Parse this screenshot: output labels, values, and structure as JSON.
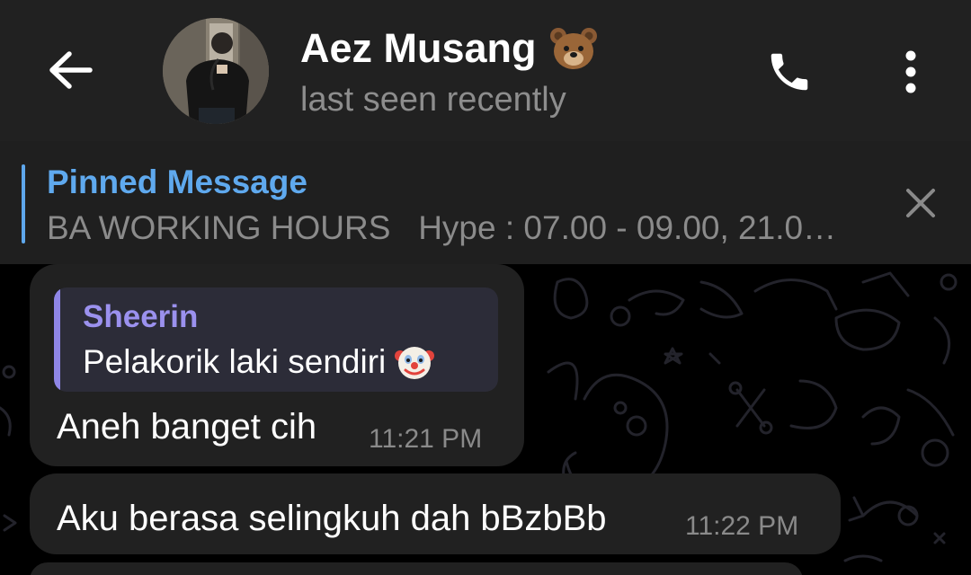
{
  "header": {
    "contact_name": "Aez Musang",
    "name_emoji": "bear-face-icon",
    "status": "last seen recently"
  },
  "pinned": {
    "title": "Pinned Message",
    "text": "BA WORKING HOURS   Hype : 07.00 - 09.00, 21.0…"
  },
  "messages": [
    {
      "reply": {
        "sender": "Sheerin",
        "text": "Pelakorik laki sendiri",
        "emoji": "clown-face-icon"
      },
      "text": "Aneh banget cih",
      "time": "11:21 PM"
    },
    {
      "text": "Aku berasa selingkuh dah bBzbBb",
      "time": "11:22 PM"
    }
  ],
  "colors": {
    "header_bg": "#212121",
    "chat_bg": "#000000",
    "bubble_bg": "#212121",
    "pinned_accent": "#5ea7ec",
    "reply_accent": "#8f86e6"
  }
}
